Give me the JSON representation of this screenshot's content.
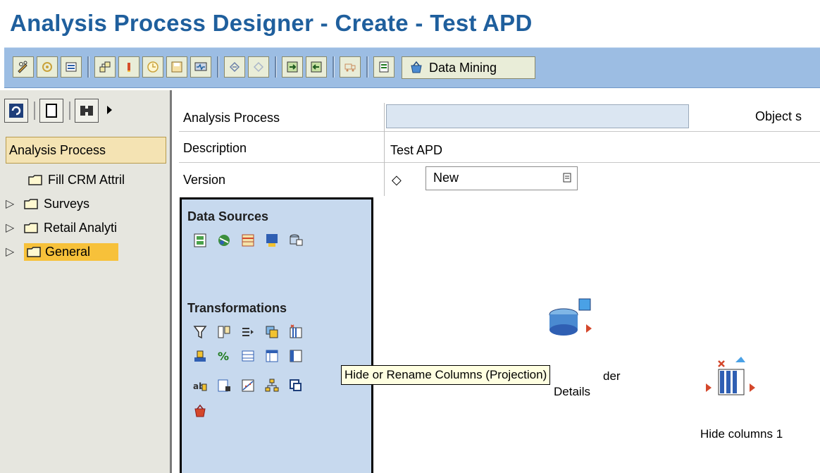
{
  "window": {
    "title": "Analysis Process Designer - Create - Test APD"
  },
  "toolbar": {
    "icons": [
      "change-icon",
      "assign-icon",
      "list-icon",
      "hierarchy-icon",
      "info-icon",
      "clock-icon",
      "save-icon",
      "monitor-icon",
      "undo-icon",
      "redo-icon",
      "transport-in-icon",
      "transport-out-icon",
      "truck-icon",
      "doc-icon",
      "basket-icon"
    ],
    "data_mining_label": "Data Mining"
  },
  "leftnav": {
    "header": "Analysis Process",
    "items": [
      {
        "label": "Fill CRM Attril",
        "expandable": false
      },
      {
        "label": "Surveys",
        "expandable": true
      },
      {
        "label": "Retail Analyti",
        "expandable": true
      },
      {
        "label": "General",
        "expandable": true,
        "selected": true
      }
    ]
  },
  "form": {
    "analysis_process_label": "Analysis Process",
    "analysis_process_value": "",
    "object_label": "Object s",
    "description_label": "Description",
    "description_value": "Test APD",
    "version_label": "Version",
    "version_symbol": "◇",
    "version_value": "New"
  },
  "palette": {
    "data_sources_title": "Data Sources",
    "transformations_title": "Transformations"
  },
  "canvas": {
    "node1_label_partial": "der",
    "node1_label_line2": "Details",
    "node2_label": "Hide columns 1",
    "tooltip": "Hide or Rename Columns (Projection)"
  },
  "colors": {
    "title": "#1f5f9d",
    "toolbar_bg": "#9cbde3",
    "palette_bg": "#c7d9ee",
    "selected_folder": "#f7c13a",
    "tooltip_bg": "#ffffe1"
  }
}
